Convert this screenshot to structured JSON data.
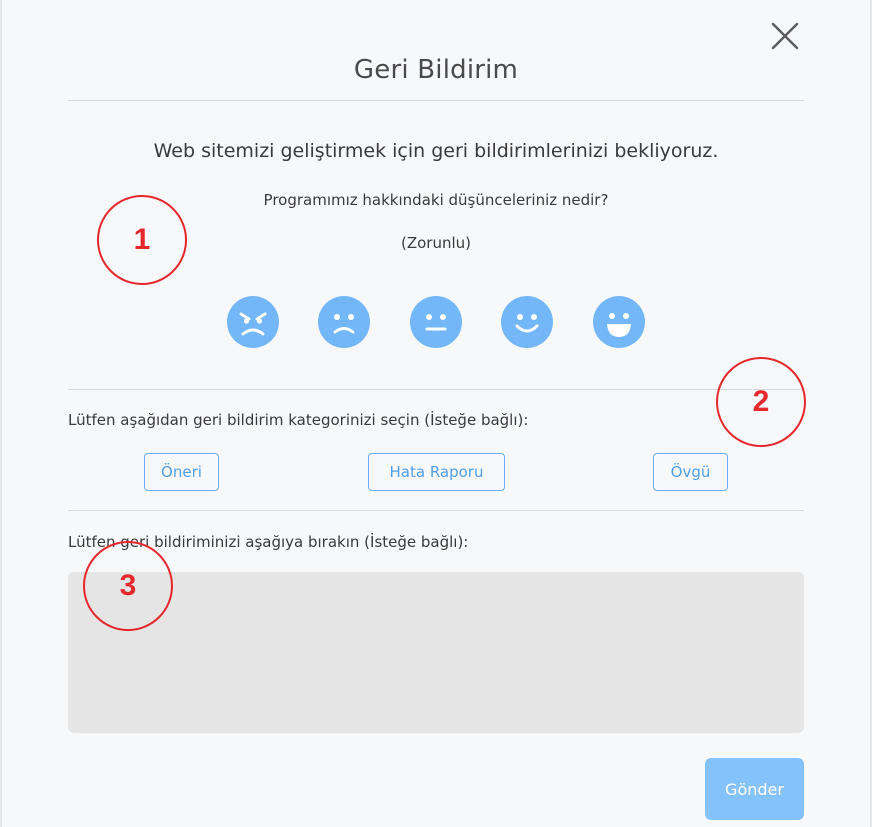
{
  "dialog": {
    "title": "Geri Bildirim",
    "subtitle": "Web sitemizi geliştirmek için geri bildirimlerinizi bekliyoruz.",
    "rating_question": "Programımız hakkındaki düşünceleriniz nedir?",
    "rating_required": "(Zorunlu)",
    "ratings": [
      {
        "icon": "angry-face-icon"
      },
      {
        "icon": "sad-face-icon"
      },
      {
        "icon": "neutral-face-icon"
      },
      {
        "icon": "smile-face-icon"
      },
      {
        "icon": "laughing-face-icon"
      }
    ],
    "category_prompt": "Lütfen aşağıdan geri bildirim kategorinizi seçin (İsteğe bağlı):",
    "categories": [
      "Öneri",
      "Hata Raporu",
      "Övgü"
    ],
    "feedback_prompt": "Lütfen geri bildiriminizi aşağıya bırakın (İsteğe bağlı):",
    "feedback_value": "",
    "submit_label": "Gönder",
    "close_icon": "close-icon"
  },
  "annotations": [
    "1",
    "2",
    "3"
  ],
  "colors": {
    "accent": "#73b7f9",
    "button_border": "#6cb0f2",
    "submit_bg": "#84c2fb",
    "annotation": "#e5282c",
    "textarea_bg": "#e5e5e5"
  }
}
